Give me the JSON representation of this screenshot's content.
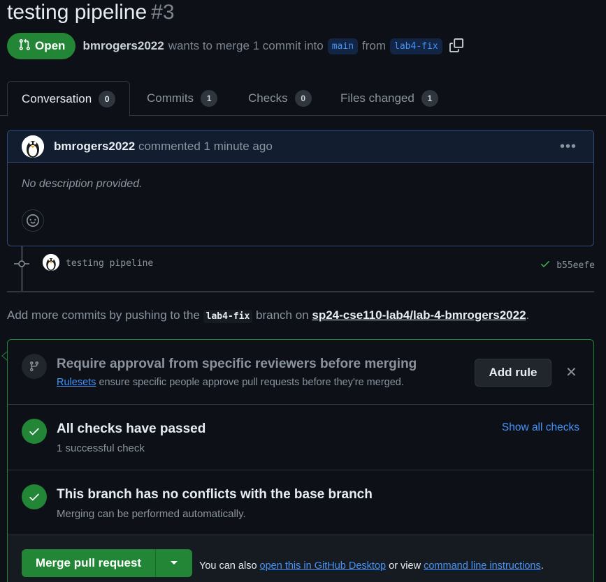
{
  "pr": {
    "title": "testing pipeline",
    "number": "#3",
    "state": "Open",
    "author": "bmrogers2022",
    "action_text": "wants to merge 1 commit into",
    "base_branch": "main",
    "from_text": "from",
    "head_branch": "lab4-fix"
  },
  "tabs": [
    {
      "label": "Conversation",
      "count": "0"
    },
    {
      "label": "Commits",
      "count": "1"
    },
    {
      "label": "Checks",
      "count": "0"
    },
    {
      "label": "Files changed",
      "count": "1"
    }
  ],
  "comment": {
    "author": "bmrogers2022",
    "meta": "commented 1 minute ago",
    "body": "No description provided."
  },
  "commit": {
    "message": "testing pipeline",
    "sha": "b55eefe"
  },
  "info": {
    "prefix": "Add more commits by pushing to the",
    "branch": "lab4-fix",
    "middle": "branch on",
    "repo": "sp24-cse110-lab4/lab-4-bmrogers2022",
    "suffix": "."
  },
  "merge_box": {
    "rules_title": "Require approval from specific reviewers before merging",
    "rules_link": "Rulesets",
    "rules_sub": "ensure specific people approve pull requests before they're merged.",
    "add_rule_label": "Add rule",
    "checks_title": "All checks have passed",
    "checks_sub": "1 successful check",
    "show_all_checks": "Show all checks",
    "conflicts_title": "This branch has no conflicts with the base branch",
    "conflicts_sub": "Merging can be performed automatically.",
    "merge_button": "Merge pull request",
    "alt_prefix": "You can also",
    "alt_link1": "open this in GitHub Desktop",
    "alt_middle": "or view",
    "alt_link2": "command line instructions",
    "alt_suffix": "."
  },
  "colors": {
    "background": "#0d1117",
    "accent_green": "#238636",
    "link_blue": "#4493f8",
    "muted": "#8b949e"
  },
  "icons": [
    "git-pull-request-icon",
    "copy-icon",
    "kebab-icon",
    "smiley-icon",
    "git-commit-icon",
    "check-icon",
    "git-branch-icon",
    "close-icon",
    "triangle-down-icon"
  ]
}
